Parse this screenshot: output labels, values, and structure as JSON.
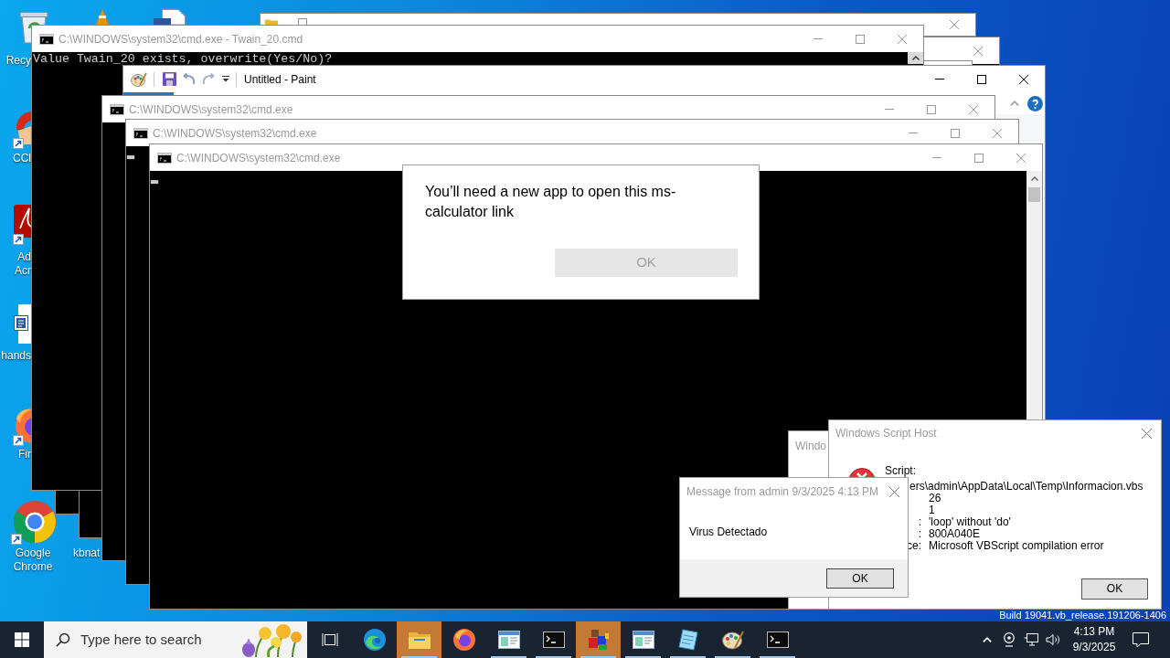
{
  "desktop_icons": [
    {
      "kind": "recycle_bin",
      "label": "Recy"
    },
    {
      "kind": "cone"
    },
    {
      "kind": "document"
    },
    {
      "kind": "cleaner",
      "label": "CCl"
    },
    {
      "kind": "pdf",
      "label": "Ad Acr"
    },
    {
      "kind": "word",
      "label": "hands"
    },
    {
      "kind": "firefox",
      "label": "Fir"
    },
    {
      "kind": "chrome",
      "label": "Google Chrome"
    },
    {
      "kind": "covered",
      "label": "kbnat"
    }
  ],
  "build_info": "Build 19041.vb_release.191206-1406",
  "windows": [
    {
      "kind": "explorer"
    },
    {
      "kind": "console_back"
    },
    {
      "kind": "console_back"
    },
    {
      "kind": "console",
      "title": "C:\\WINDOWS\\system32\\cmd.exe - Twain_20.cmd",
      "active": false,
      "lines": [
        "Value Twain_20 exists, overwrite(Yes/No)?"
      ]
    },
    {
      "kind": "paint",
      "title": "Untitled - Paint",
      "active": true
    },
    {
      "kind": "console",
      "title": "C:\\WINDOWS\\system32\\cmd.exe",
      "active": false
    },
    {
      "kind": "console",
      "title": "C:\\WINDOWS\\system32\\cmd.exe",
      "active": false,
      "lines": [
        "▂"
      ]
    },
    {
      "kind": "console",
      "title": "C:\\WINDOWS\\system32\\cmd.exe",
      "active": false,
      "lines": [
        "▂"
      ]
    }
  ],
  "app_prompt": {
    "message": "You’ll need a new app to open this ms-calculator link",
    "button": {
      "label": "OK",
      "disabled": true
    }
  },
  "covered_dialog": {
    "title": "Windo"
  },
  "script_host": {
    "title": "Windows Script Host",
    "script_label": "Script:",
    "script_path": "ers\\admin\\AppData\\Local\\Temp\\Informacion.vbs",
    "fields": [
      {
        "value": "26"
      },
      {
        "value": "1"
      },
      {
        "label": ":",
        "value": "'loop' without 'do'"
      },
      {
        "label": ":",
        "value": "800A040E"
      },
      {
        "label": "ce:",
        "value": "Microsoft VBScript compilation error"
      }
    ],
    "button": "OK"
  },
  "message_box": {
    "title": "Message from admin 9/3/2025 4:13 PM",
    "text": "Virus Detectado",
    "button": "OK"
  },
  "taskbar": {
    "search": {
      "placeholder": "Type here to search"
    },
    "apps": [
      {
        "kind": "task_view",
        "running": false,
        "flashing": false
      },
      {
        "kind": "edge",
        "running": false,
        "flashing": false
      },
      {
        "kind": "folder",
        "running": true,
        "flashing": true
      },
      {
        "kind": "firefox",
        "running": false,
        "flashing": false
      },
      {
        "kind": "app_window",
        "running": true,
        "flashing": false
      },
      {
        "kind": "terminal",
        "running": true,
        "flashing": false
      },
      {
        "kind": "boxes",
        "running": true,
        "flashing": true
      },
      {
        "kind": "app_window",
        "running": true,
        "flashing": false
      },
      {
        "kind": "page",
        "running": true,
        "flashing": false
      },
      {
        "kind": "palette",
        "running": true,
        "flashing": false
      },
      {
        "kind": "terminal",
        "running": true,
        "flashing": false
      }
    ],
    "tray": {
      "time": "4:13 PM",
      "date": "9/3/2025"
    }
  }
}
